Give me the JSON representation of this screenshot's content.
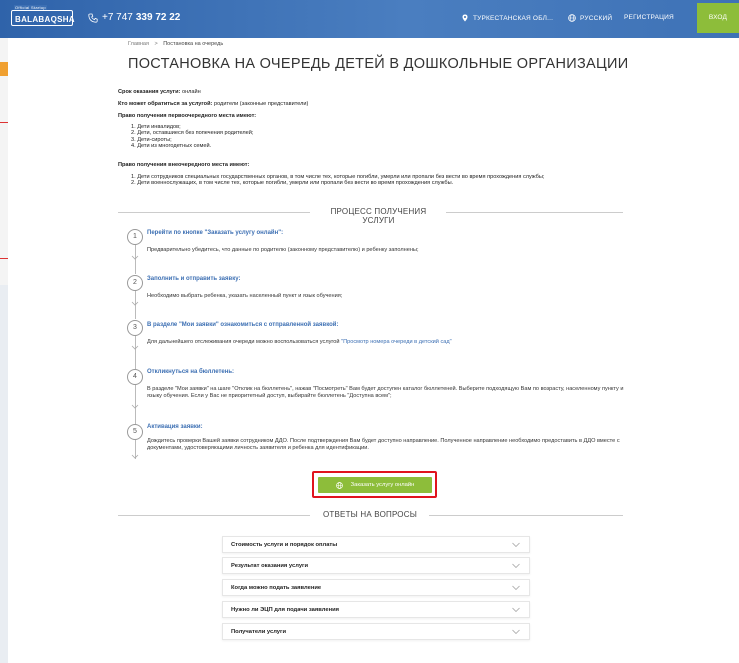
{
  "header": {
    "logo_small": "Official Startup",
    "logo": "BALABAQSHA",
    "phone_prefix": "+7 747",
    "phone_number": "339 72 22",
    "region": "ТУРКЕСТАНСКАЯ ОБЛ...",
    "language": "РУССКИЙ",
    "register": "РЕГИСТРАЦИЯ",
    "login": "ВХОД"
  },
  "breadcrumb": {
    "home": "Главная",
    "separator": ">",
    "current": "Постановка на очередь"
  },
  "title": "ПОСТАНОВКА НА ОЧЕРЕДЬ ДЕТЕЙ В ДОШКОЛЬНЫЕ ОРГАНИЗАЦИИ",
  "info": {
    "term_label": "Срок оказания услуги:",
    "term_value": "онлайн",
    "who_label": "Кто может обратиться за услугой:",
    "who_value": "родители (законные представители)",
    "priority_label": "Право получения первоочередного места имеют:",
    "priority_items": [
      "1. Дети инвалидов;",
      "2. Дети, оставшиеся без попечения родителей;",
      "3. Дети-сироты;",
      "4. Дети из многодетных семей."
    ],
    "extra_label": "Право получения внеочередного места имеют:",
    "extra_items": [
      "1. Дети сотрудников специальных государственных органов, в том числе тех, которые погибли, умерли или пропали без вести во время прохождения службы;",
      "2. Дети военнослужащих, в том числе тех, которые погибли, умерли или пропали без вести во время прохождения службы."
    ]
  },
  "process": {
    "heading": "ПРОЦЕСС ПОЛУЧЕНИЯ УСЛУГИ",
    "steps": [
      {
        "num": "1",
        "title": "Перейти по кнопке \"Заказать услугу онлайн\":",
        "text": "Предварительно убедитесь, что данные по родителю (законному представителю) и ребенку заполнены;"
      },
      {
        "num": "2",
        "title": "Заполнить и отправить заявку:",
        "text": "Необходимо выбрать ребенка, указать населенный пункт и язык обучения;"
      },
      {
        "num": "3",
        "title": "В разделе \"Мои заявки\" ознакомиться с отправленной заявкой:",
        "text": "Для дальнейшего отслеживания очереди можно воспользоваться услугой",
        "link": "\"Просмотр номера очереди в детский сад\""
      },
      {
        "num": "4",
        "title": "Откликнуться на бюллетень:",
        "text": "В разделе \"Мои заявки\" на шаге \"Отклик на бюллетень\", нажав \"Посмотреть\" Вам будет доступен каталог бюллетеней. Выберите подходящую Вам по возрасту, населенному пункту и языку обучения. Если у Вас не приоритетный доступ, выбирайте бюллетень \"Доступна всем\";"
      },
      {
        "num": "5",
        "title": "Активация заявки:",
        "text": "Дождитесь проверки Вашей заявки сотрудником ДДО. После подтверждения Вам будет доступно направление. Полученное направление необходимо предоставить в ДДО вместе с документами, удостоверяющими личность заявителя и ребенка для идентификации."
      }
    ],
    "order_button": "Заказать услугу онлайн"
  },
  "faq": {
    "heading": "ОТВЕТЫ НА ВОПРОСЫ",
    "items": [
      "Стоимость услуги и порядок оплаты",
      "Результат оказания услуги",
      "Когда можно подать заявление",
      "Нужно ли ЭЦП для подачи заявления",
      "Получатели услуги"
    ]
  },
  "colors": {
    "header": "#3c6fb3",
    "accent_green": "#8dbd3a",
    "link": "#3c6fb3",
    "highlight": "#e0141e"
  }
}
